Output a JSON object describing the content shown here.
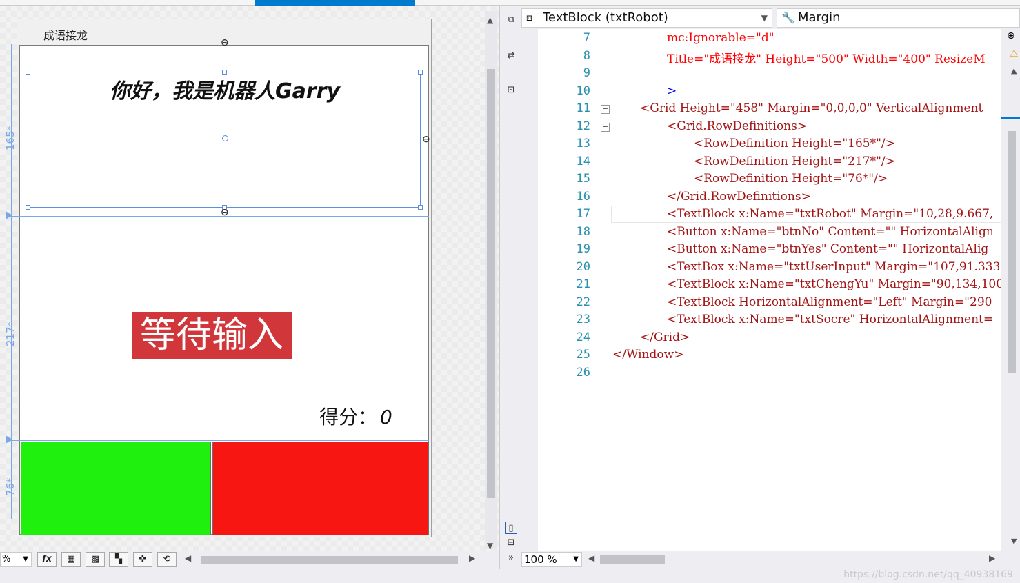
{
  "window": {
    "title": "成语接龙"
  },
  "designer": {
    "robot_text": "你好，我是机器人Garry",
    "chengyu_text": "等待输入",
    "score_label": "得分：",
    "score_value": "0",
    "row_labels": [
      "165*",
      "217*",
      "76*"
    ],
    "colors": {
      "yes_button": "#1ff00d",
      "no_button": "#f81612",
      "chengyu_bg": "#d1363a",
      "selection": "#5b8edb"
    },
    "zoom_value": "%",
    "toolbar_fx": "fx"
  },
  "editor": {
    "element_selector": "TextBlock (txtRobot)",
    "property_selector": "Margin",
    "zoom": "100 %",
    "line_numbers": [
      "7",
      "8",
      "9",
      "10",
      "11",
      "12",
      "13",
      "14",
      "15",
      "16",
      "17",
      "18",
      "19",
      "20",
      "21",
      "22",
      "23",
      "24",
      "25",
      "26"
    ],
    "lines": {
      "l7": "mc:Ignorable=\"d\"",
      "l8a": "Title=\"成语接龙\"",
      "l8b": " Height=\"500\"",
      "l8c": " Width=\"400\"",
      "l8d": " ResizeM",
      "l10": ">",
      "l11": "<Grid Height=\"458\" Margin=\"0,0,0,0\" VerticalAlignment",
      "l12": "<Grid.RowDefinitions>",
      "l13": "<RowDefinition Height=\"165*\"/>",
      "l14": "<RowDefinition Height=\"217*\"/>",
      "l15": "<RowDefinition Height=\"76*\"/>",
      "l16": "</Grid.RowDefinitions>",
      "l17": "<TextBlock x:Name=\"txtRobot\" Margin=\"10,28,9.667,",
      "l18": "<Button x:Name=\"btnNo\" Content=\"\" HorizontalAlign",
      "l19": "<Button x:Name=\"btnYes\" Content=\"\" HorizontalAlig",
      "l20": "<TextBox x:Name=\"txtUserInput\" Margin=\"107,91.333",
      "l21": "<TextBlock x:Name=\"txtChengYu\" Margin=\"90,134,100",
      "l22": "<TextBlock HorizontalAlignment=\"Left\" Margin=\"290",
      "l23": "<TextBlock x:Name=\"txtSocre\" HorizontalAlignment=",
      "l24": "</Grid>",
      "l25": "</Window>"
    }
  },
  "watermark": "https://blog.csdn.net/qq_40938169"
}
